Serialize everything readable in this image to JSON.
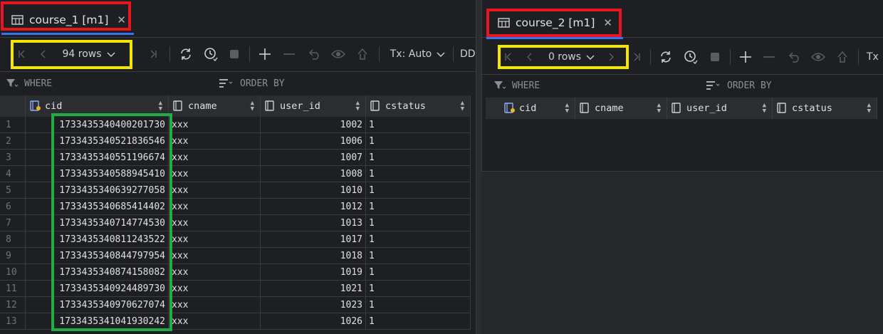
{
  "left": {
    "tab": {
      "label": "course_1 [m1]",
      "close": "✕"
    },
    "toolbar": {
      "rows_label": "94 rows",
      "tx_label": "Tx: Auto",
      "ddl_label": "DD"
    },
    "filters": {
      "where": "WHERE",
      "order_by": "ORDER BY"
    },
    "columns": [
      "cid",
      "cname",
      "user_id",
      "cstatus"
    ],
    "rows": [
      {
        "n": "1",
        "cid": "1733435340400201730",
        "cname": "xxx",
        "user_id": "1002",
        "cstatus": "1"
      },
      {
        "n": "2",
        "cid": "1733435340521836546",
        "cname": "xxx",
        "user_id": "1006",
        "cstatus": "1"
      },
      {
        "n": "3",
        "cid": "1733435340551196674",
        "cname": "xxx",
        "user_id": "1007",
        "cstatus": "1"
      },
      {
        "n": "4",
        "cid": "1733435340588945410",
        "cname": "xxx",
        "user_id": "1008",
        "cstatus": "1"
      },
      {
        "n": "5",
        "cid": "1733435340639277058",
        "cname": "xxx",
        "user_id": "1010",
        "cstatus": "1"
      },
      {
        "n": "6",
        "cid": "1733435340685414402",
        "cname": "xxx",
        "user_id": "1012",
        "cstatus": "1"
      },
      {
        "n": "7",
        "cid": "1733435340714774530",
        "cname": "xxx",
        "user_id": "1013",
        "cstatus": "1"
      },
      {
        "n": "8",
        "cid": "1733435340811243522",
        "cname": "xxx",
        "user_id": "1017",
        "cstatus": "1"
      },
      {
        "n": "9",
        "cid": "1733435340844797954",
        "cname": "xxx",
        "user_id": "1018",
        "cstatus": "1"
      },
      {
        "n": "10",
        "cid": "1733435340874158082",
        "cname": "xxx",
        "user_id": "1019",
        "cstatus": "1"
      },
      {
        "n": "11",
        "cid": "1733435340924489730",
        "cname": "xxx",
        "user_id": "1021",
        "cstatus": "1"
      },
      {
        "n": "12",
        "cid": "1733435340970627074",
        "cname": "xxx",
        "user_id": "1023",
        "cstatus": "1"
      },
      {
        "n": "13",
        "cid": "1733435341041930242",
        "cname": "xxx",
        "user_id": "1026",
        "cstatus": "1"
      }
    ]
  },
  "right": {
    "tab": {
      "label": "course_2 [m1]",
      "close": "✕"
    },
    "toolbar": {
      "rows_label": "0 rows",
      "tx_label": "Tx"
    },
    "filters": {
      "where": "WHERE",
      "order_by": "ORDER BY"
    },
    "columns": [
      "cid",
      "cname",
      "user_id",
      "cstatus"
    ]
  },
  "colors": {
    "highlight_tab": "#e8141e",
    "highlight_rows": "#f5e600",
    "highlight_cid": "#1fae43",
    "accent": "#3574f0"
  }
}
